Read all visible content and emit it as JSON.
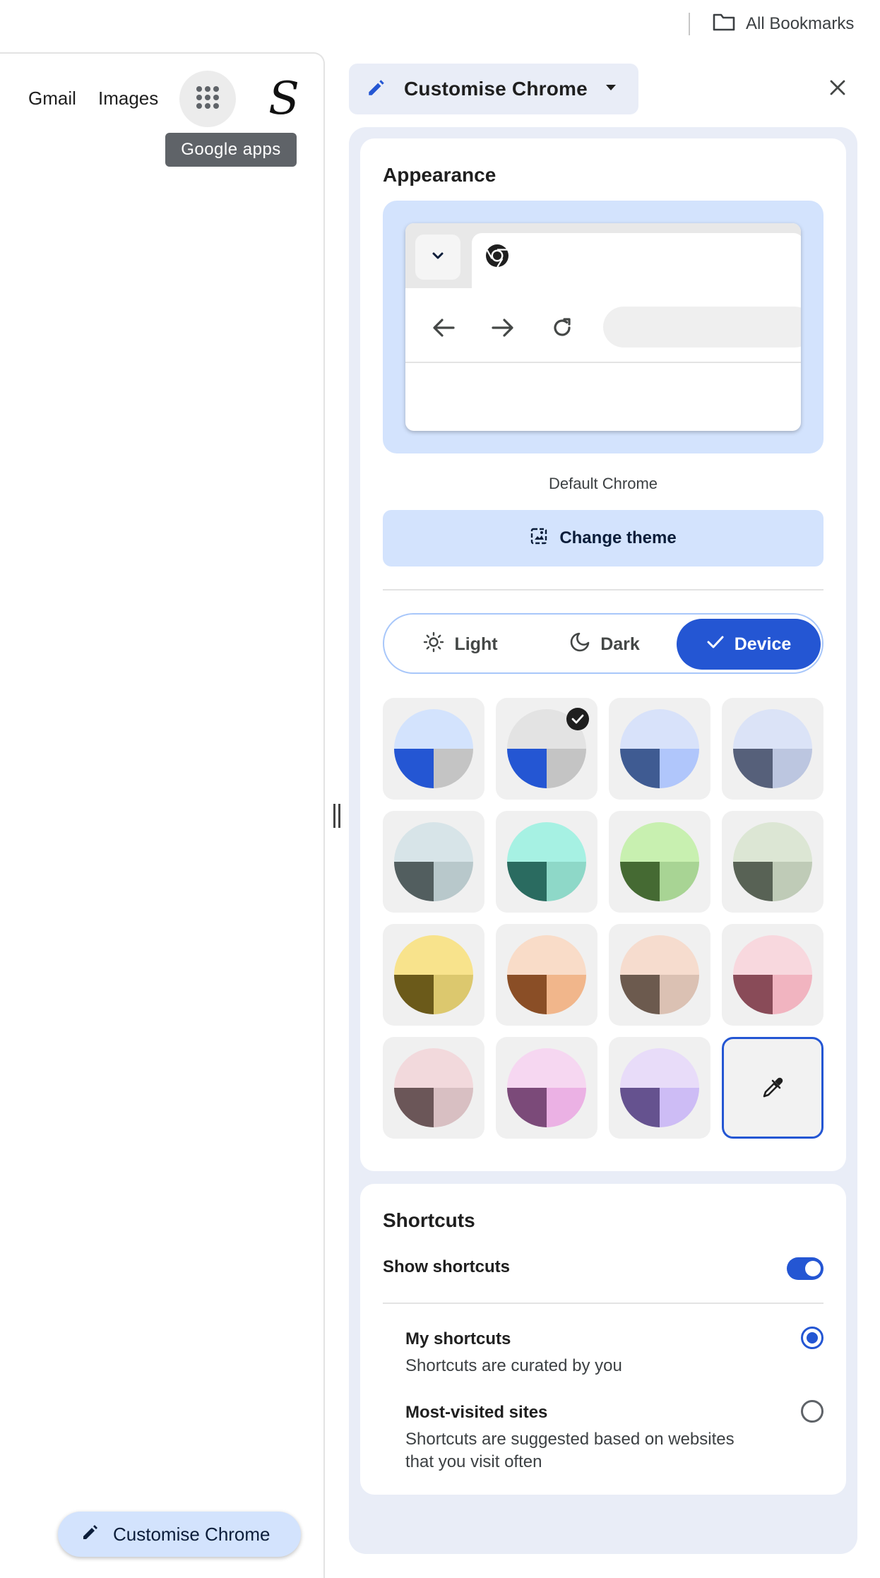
{
  "bookmarks": {
    "label": "All Bookmarks",
    "icon": "folder-icon"
  },
  "google_bar": {
    "gmail": "Gmail",
    "images": "Images",
    "apps_tooltip": "Google apps",
    "avatar_letter": "S"
  },
  "customise_pill": {
    "label": "Customise Chrome"
  },
  "panel": {
    "title": "Customise Chrome",
    "appearance": {
      "title": "Appearance",
      "theme_name": "Default Chrome",
      "change_theme": "Change theme",
      "modes": [
        {
          "label": "Light",
          "selected": false
        },
        {
          "label": "Dark",
          "selected": false
        },
        {
          "label": "Device",
          "selected": true
        }
      ],
      "color_swatches": [
        {
          "top": "#d3e3fd",
          "left": "#2456d3",
          "right": "#c4c4c4",
          "selected": false
        },
        {
          "top": "#e3e3e3",
          "left": "#2456d3",
          "right": "#c4c4c4",
          "selected": true
        },
        {
          "top": "#d8e2fa",
          "left": "#3f5b92",
          "right": "#b0c6fb",
          "selected": false
        },
        {
          "top": "#dbe3f7",
          "left": "#56607a",
          "right": "#bcc6e0",
          "selected": false
        },
        {
          "top": "#d7e4e8",
          "left": "#525e5f",
          "right": "#b8c8cb",
          "selected": false
        },
        {
          "top": "#a6f1e3",
          "left": "#2a6b60",
          "right": "#8ed8c8",
          "selected": false
        },
        {
          "top": "#c8f0b0",
          "left": "#456a33",
          "right": "#a8d494",
          "selected": false
        },
        {
          "top": "#dce6d4",
          "left": "#586255",
          "right": "#bfcbb7",
          "selected": false
        },
        {
          "top": "#f8e38c",
          "left": "#6b5a1a",
          "right": "#dcc86e",
          "selected": false
        },
        {
          "top": "#f9dcc8",
          "left": "#8a4e26",
          "right": "#f1b68b",
          "selected": false
        },
        {
          "top": "#f6dcce",
          "left": "#6c5a4e",
          "right": "#dbc1b3",
          "selected": false
        },
        {
          "top": "#f8d8de",
          "left": "#894b58",
          "right": "#f1b4c0",
          "selected": false
        },
        {
          "top": "#f2d9dc",
          "left": "#6b5658",
          "right": "#d8bfc2",
          "selected": false
        },
        {
          "top": "#f6d7f1",
          "left": "#7b4a79",
          "right": "#ebb1e4",
          "selected": false
        },
        {
          "top": "#e8dcf9",
          "left": "#65528f",
          "right": "#cdbcf5",
          "selected": false
        }
      ],
      "custom_color_icon": "eyedropper-icon"
    },
    "shortcuts": {
      "title": "Shortcuts",
      "show_label": "Show shortcuts",
      "show_enabled": true,
      "options": [
        {
          "title": "My shortcuts",
          "description": "Shortcuts are curated by you",
          "selected": true
        },
        {
          "title": "Most-visited sites",
          "description_line1": "Shortcuts are suggested based on websites",
          "description_line2": "that you visit often",
          "selected": false
        }
      ]
    }
  }
}
